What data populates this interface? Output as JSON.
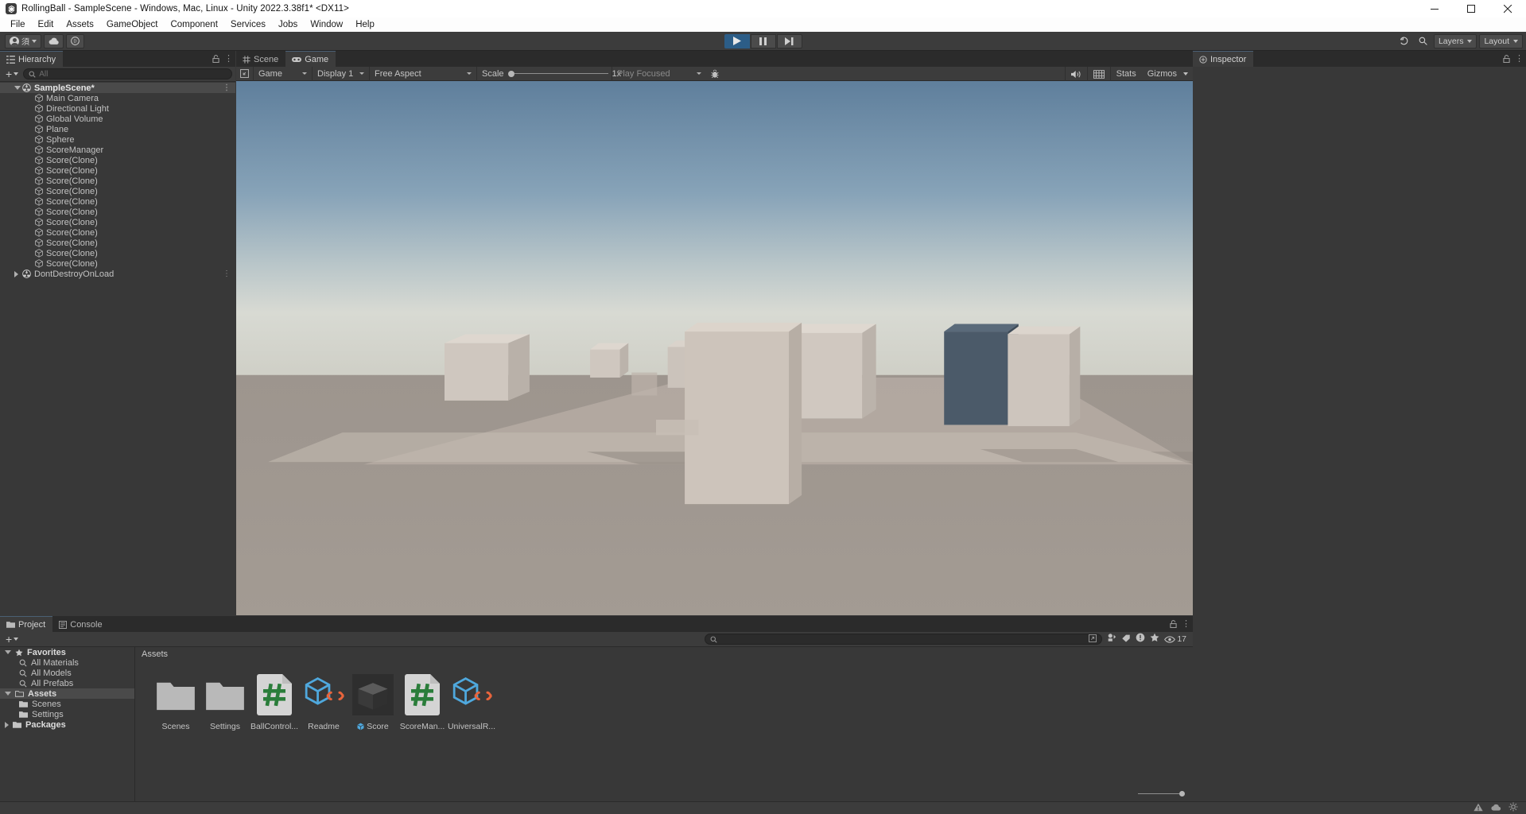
{
  "window": {
    "title": "RollingBall - SampleScene - Windows, Mac, Linux - Unity 2022.3.38f1* <DX11>",
    "app_icon": "unity-icon",
    "minimize": "minimize-icon",
    "maximize": "maximize-icon",
    "close": "close-icon"
  },
  "menubar": {
    "items": [
      "File",
      "Edit",
      "Assets",
      "GameObject",
      "Component",
      "Services",
      "Jobs",
      "Window",
      "Help"
    ]
  },
  "toolbar": {
    "account_icon": "account-icon",
    "account_label": "須",
    "cloud_icon": "cloud-icon",
    "services_icon": "unity-services-icon",
    "play": "play-icon",
    "pause": "pause-icon",
    "step": "step-icon",
    "undo_history": "undo-history-icon",
    "search_icon": "search-icon",
    "layers_label": "Layers",
    "layout_label": "Layout"
  },
  "hierarchy": {
    "tab_label": "Hierarchy",
    "tab_icon": "hierarchy-icon",
    "lock_icon": "lock-icon",
    "menu_icon": "kebab-icon",
    "add_label": "+",
    "search_placeholder": "All",
    "search_icon": "search-icon",
    "scene_name": "SampleScene*",
    "objects": [
      "Main Camera",
      "Directional Light",
      "Global Volume",
      "Plane",
      "Sphere",
      "ScoreManager",
      "Score(Clone)",
      "Score(Clone)",
      "Score(Clone)",
      "Score(Clone)",
      "Score(Clone)",
      "Score(Clone)",
      "Score(Clone)",
      "Score(Clone)",
      "Score(Clone)",
      "Score(Clone)",
      "Score(Clone)"
    ],
    "dont_destroy_on_load": "DontDestroyOnLoad"
  },
  "gameview": {
    "tabs": [
      {
        "label": "Scene",
        "icon": "scene-grid-icon",
        "active": false
      },
      {
        "label": "Game",
        "icon": "gamepad-icon",
        "active": true
      }
    ],
    "lock_icon": "lock-icon",
    "menu_icon": "kebab-icon",
    "display_target": "Game",
    "display_number": "Display 1",
    "aspect": "Free Aspect",
    "scale_label": "Scale",
    "scale_value": "1x",
    "play_mode": "Play Focused",
    "mute_icon": "mute-audio-icon",
    "stats_label": "Stats",
    "gizmos_label": "Gizmos",
    "gizmos_caret": "chevron-down-icon",
    "bug_icon": "bug-icon",
    "aspect_ratio_icon": "aspect-ratio-icon"
  },
  "inspector": {
    "tab_label": "Inspector",
    "tab_icon": "inspector-icon",
    "lock_icon": "lock-icon",
    "menu_icon": "kebab-icon"
  },
  "project": {
    "tabs": [
      {
        "label": "Project",
        "icon": "folder-icon",
        "active": true
      },
      {
        "label": "Console",
        "icon": "console-icon",
        "active": false
      }
    ],
    "lock_icon": "lock-icon",
    "menu_icon": "kebab-icon",
    "add_label": "+",
    "search_placeholder": "",
    "search_icon": "search-icon",
    "filter_icons": [
      "save-search-icon",
      "type-filter-icon",
      "label-filter-icon",
      "warning-filter-icon",
      "favorite-filter-icon"
    ],
    "visible_count": "17",
    "eye_icon": "eye-icon",
    "breadcrumb": "Assets",
    "tree": [
      {
        "label": "Favorites",
        "icon": "star-icon",
        "level": 0,
        "expanded": true,
        "selected": false,
        "bold": true
      },
      {
        "label": "All Materials",
        "icon": "search-icon",
        "level": 1,
        "selected": false,
        "bold": false
      },
      {
        "label": "All Models",
        "icon": "search-icon",
        "level": 1,
        "selected": false,
        "bold": false
      },
      {
        "label": "All Prefabs",
        "icon": "search-icon",
        "level": 1,
        "selected": false,
        "bold": false
      },
      {
        "label": "Assets",
        "icon": "folder-open-icon",
        "level": 0,
        "expanded": true,
        "selected": true,
        "bold": true
      },
      {
        "label": "Scenes",
        "icon": "folder-icon",
        "level": 1,
        "selected": false,
        "bold": false
      },
      {
        "label": "Settings",
        "icon": "folder-icon",
        "level": 1,
        "selected": false,
        "bold": false
      },
      {
        "label": "Packages",
        "icon": "folder-icon",
        "level": 0,
        "expanded": false,
        "selected": false,
        "bold": true
      }
    ],
    "assets": [
      {
        "name": "Scenes",
        "thumb": "folder-thumb"
      },
      {
        "name": "Settings",
        "thumb": "folder-thumb"
      },
      {
        "name": "BallControl...",
        "thumb": "csharp-script-thumb"
      },
      {
        "name": "Readme",
        "thumb": "scriptable-object-thumb"
      },
      {
        "name": "Score",
        "thumb": "prefab-preview-thumb",
        "badge": "prefab-icon",
        "selected": true
      },
      {
        "name": "ScoreMan...",
        "thumb": "csharp-script-thumb"
      },
      {
        "name": "UniversalR...",
        "thumb": "scriptable-object-thumb"
      }
    ]
  },
  "statusbar": {
    "icons": [
      "warning-icon",
      "cloud-status-icon",
      "settings-icon"
    ]
  },
  "colors": {
    "accent_blue": "#2c5d87",
    "panel_bg": "#383838",
    "toolbar_bg": "#3c3c3c",
    "tabbar_bg": "#2b2b2b",
    "selection": "#4a4a4a",
    "text": "#c2c2c2",
    "sky_top": "#6e8ea8",
    "sky_bottom": "#cfd2cf",
    "ground": "#b8aea6"
  }
}
